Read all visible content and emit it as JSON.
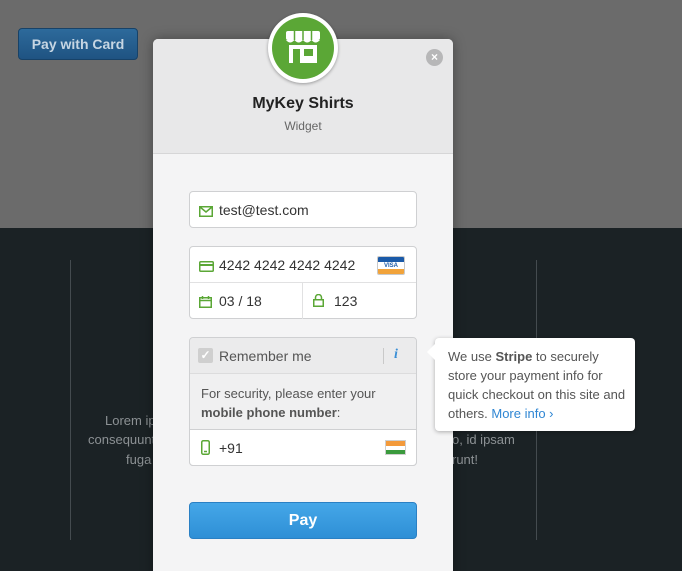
{
  "background": {
    "pay_with_card_label": "Pay with Card",
    "lorem_line1": "Lorem ip",
    "lorem_line2": "consequunt",
    "lorem_line3": "fuga",
    "lorem_right1": "o, id ipsam",
    "lorem_right2": "runt!"
  },
  "modal": {
    "close_symbol": "×",
    "title": "MyKey Shirts",
    "subtitle": "Widget",
    "email_value": "test@test.com",
    "card_number": "4242 4242 4242 4242",
    "card_brand": "VISA",
    "expiry": "03 / 18",
    "cvc": "123",
    "remember_label": "Remember me",
    "info_symbol": "i",
    "security_text_prefix": "For security, please enter your",
    "security_text_bold": "mobile phone number",
    "security_text_suffix": ":",
    "phone_value": "+91",
    "pay_label": "Pay"
  },
  "tooltip": {
    "text_1": "We use ",
    "text_bold": "Stripe",
    "text_2": " to securely store your payment info for quick checkout on this site and others. ",
    "more_info": "More info ›"
  },
  "colors": {
    "accent": "#3b8fd6",
    "brand_green": "#5ba736",
    "field_icon_green": "#5ba736"
  }
}
